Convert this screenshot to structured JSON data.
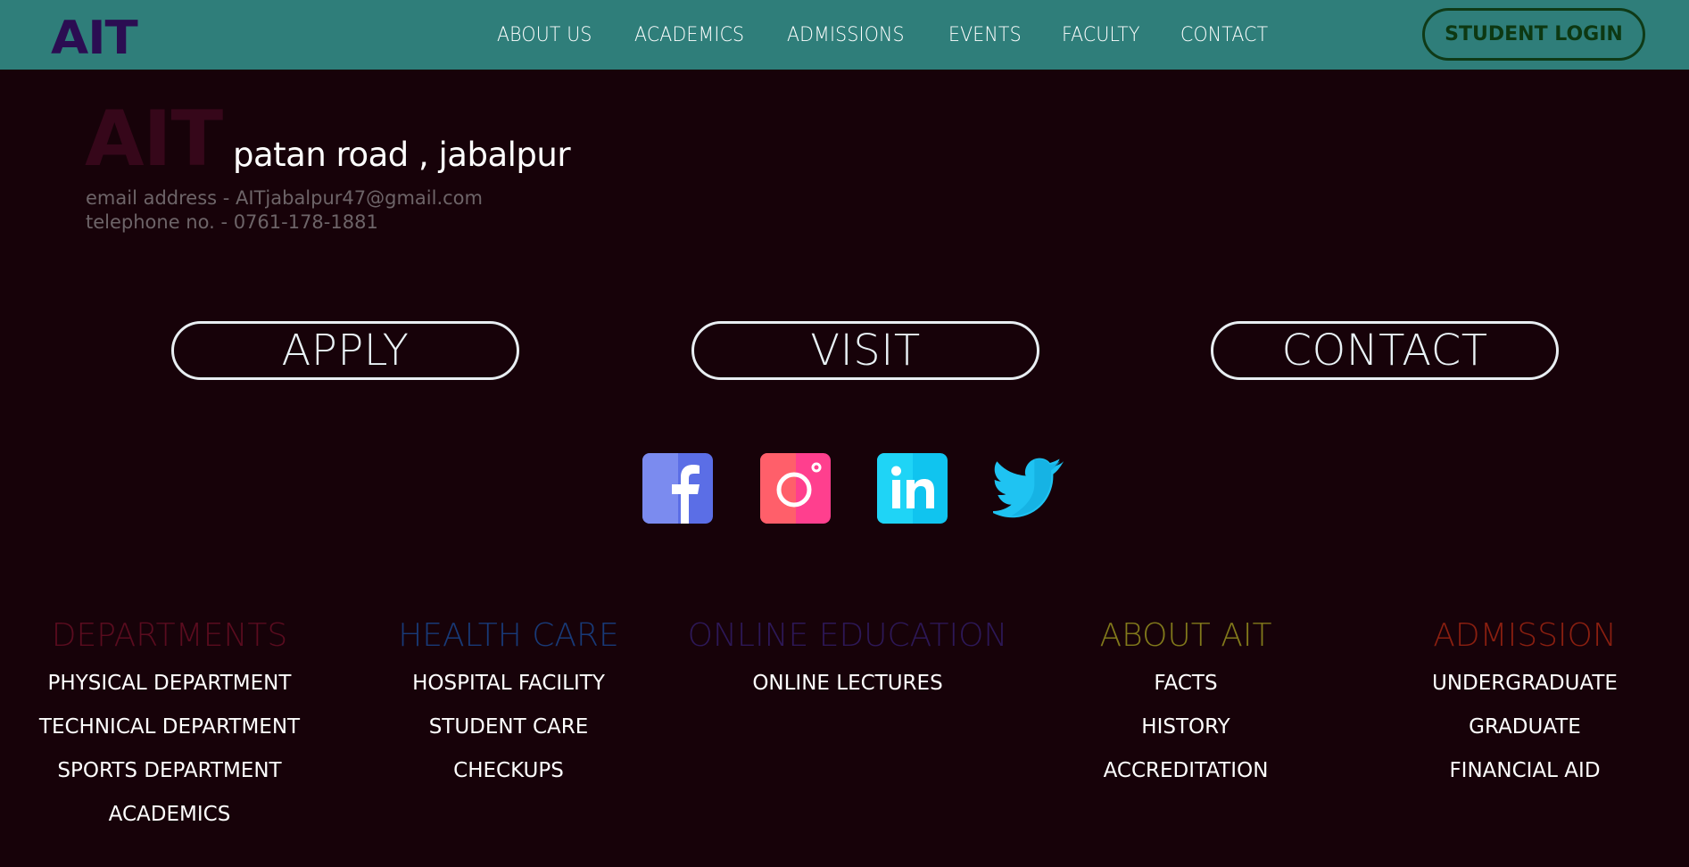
{
  "navbar": {
    "logo": "AIT",
    "links": [
      "ABOUT US",
      "ACADEMICS",
      "ADMISSIONS",
      "EVENTS",
      "FACULTY",
      "CONTACT"
    ],
    "login_label": "STUDENT LOGIN"
  },
  "address": {
    "brand": "AIT",
    "location": "patan road , jabalpur",
    "email": "email address - AITjabalpur47@gmail.com",
    "phone": "telephone no. - 0761-178-1881"
  },
  "actions": {
    "apply": "APPLY",
    "visit": "VISIT",
    "contact": "CONTACT"
  },
  "social": [
    "facebook-icon",
    "instagram-icon",
    "linkedin-icon",
    "twitter-icon"
  ],
  "footer": {
    "columns": [
      {
        "title": "DEPARTMENTS",
        "color": "#5a0c1f",
        "items": [
          "PHYSICAL DEPARTMENT",
          "TECHNICAL DEPARTMENT",
          "SPORTS DEPARTMENT",
          "ACADEMICS"
        ]
      },
      {
        "title": "HEALTH CARE",
        "color": "#183a78",
        "items": [
          "HOSPITAL FACILITY",
          "STUDENT CARE",
          "CHECKUPS"
        ]
      },
      {
        "title": "ONLINE EDUCATION",
        "color": "#2d1857",
        "items": [
          "ONLINE LECTURES"
        ]
      },
      {
        "title": "ABOUT AIT",
        "color": "#827a1b",
        "items": [
          "FACTS",
          "HISTORY",
          "ACCREDITATION"
        ]
      },
      {
        "title": "ADMISSION",
        "color": "#8a1f10",
        "items": [
          "UNDERGRADUATE",
          "GRADUATE",
          "FINANCIAL AID"
        ]
      }
    ]
  },
  "colors": {
    "navbar": "#2f7e7a",
    "background": "#170209"
  }
}
